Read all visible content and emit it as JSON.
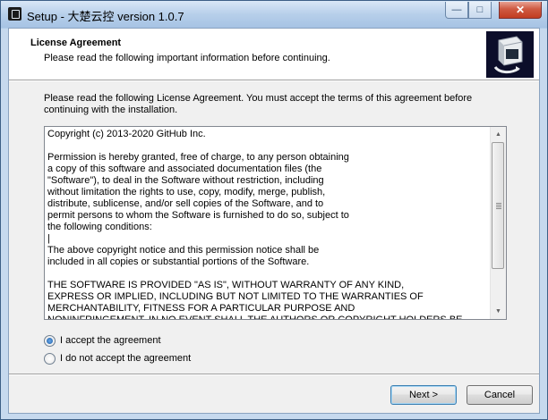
{
  "window": {
    "title": "Setup - 大楚云控 version 1.0.7",
    "controls": {
      "minimize": "—",
      "maximize": "□",
      "close": "✕"
    }
  },
  "header": {
    "title": "License Agreement",
    "subtitle": "Please read the following important information before continuing."
  },
  "intro": "Please read the following License Agreement. You must accept the terms of this agreement before continuing with the installation.",
  "license": {
    "text": "Copyright (c) 2013-2020 GitHub Inc.\n\nPermission is hereby granted, free of charge, to any person obtaining\na copy of this software and associated documentation files (the\n\"Software\"), to deal in the Software without restriction, including\nwithout limitation the rights to use, copy, modify, merge, publish,\ndistribute, sublicense, and/or sell copies of the Software, and to\npermit persons to whom the Software is furnished to do so, subject to\nthe following conditions:\n|\nThe above copyright notice and this permission notice shall be\nincluded in all copies or substantial portions of the Software.\n\nTHE SOFTWARE IS PROVIDED \"AS IS\", WITHOUT WARRANTY OF ANY KIND,\nEXPRESS OR IMPLIED, INCLUDING BUT NOT LIMITED TO THE WARRANTIES OF\nMERCHANTABILITY, FITNESS FOR A PARTICULAR PURPOSE AND\nNONINFRINGEMENT. IN NO EVENT SHALL THE AUTHORS OR COPYRIGHT HOLDERS BE"
  },
  "options": {
    "accept": {
      "label": "I accept the agreement",
      "selected": true
    },
    "decline": {
      "label": "I do not accept the agreement",
      "selected": false
    }
  },
  "buttons": {
    "next": "Next >",
    "cancel": "Cancel"
  }
}
